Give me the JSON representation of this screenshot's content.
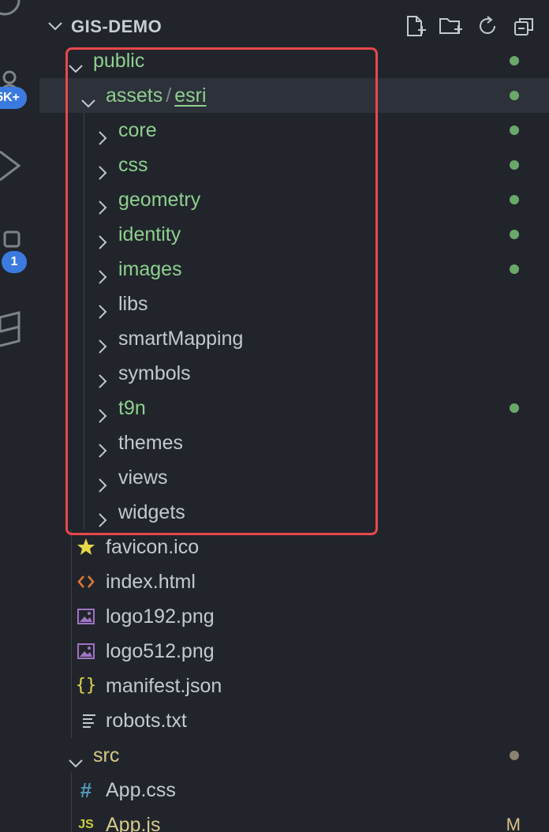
{
  "activity_bar": {
    "badge_top": "5K+",
    "badge_bottom": "1"
  },
  "explorer": {
    "section_title": "GIS-DEMO",
    "actions": [
      "new-file",
      "new-folder",
      "refresh",
      "collapse-all"
    ],
    "rows": [
      {
        "label": "public",
        "type": "folder",
        "expanded": true,
        "depth": 0,
        "color": "green",
        "status": "dot-green"
      },
      {
        "label_a": "assets",
        "label_sep": "/",
        "label_b": "esri",
        "type": "folder",
        "expanded": true,
        "depth": 1,
        "color": "green",
        "status": "dot-green"
      },
      {
        "label": "core",
        "type": "folder",
        "expanded": false,
        "depth": 2,
        "color": "green",
        "status": "dot-green"
      },
      {
        "label": "css",
        "type": "folder",
        "expanded": false,
        "depth": 2,
        "color": "green",
        "status": "dot-green"
      },
      {
        "label": "geometry",
        "type": "folder",
        "expanded": false,
        "depth": 2,
        "color": "green",
        "status": "dot-green"
      },
      {
        "label": "identity",
        "type": "folder",
        "expanded": false,
        "depth": 2,
        "color": "green",
        "status": "dot-green"
      },
      {
        "label": "images",
        "type": "folder",
        "expanded": false,
        "depth": 2,
        "color": "green",
        "status": "dot-green"
      },
      {
        "label": "libs",
        "type": "folder",
        "expanded": false,
        "depth": 2,
        "color": "grey"
      },
      {
        "label": "smartMapping",
        "type": "folder",
        "expanded": false,
        "depth": 2,
        "color": "grey"
      },
      {
        "label": "symbols",
        "type": "folder",
        "expanded": false,
        "depth": 2,
        "color": "grey"
      },
      {
        "label": "t9n",
        "type": "folder",
        "expanded": false,
        "depth": 2,
        "color": "green",
        "status": "dot-green"
      },
      {
        "label": "themes",
        "type": "folder",
        "expanded": false,
        "depth": 2,
        "color": "grey"
      },
      {
        "label": "views",
        "type": "folder",
        "expanded": false,
        "depth": 2,
        "color": "grey"
      },
      {
        "label": "widgets",
        "type": "folder",
        "expanded": false,
        "depth": 2,
        "color": "grey"
      },
      {
        "label": "favicon.ico",
        "type": "file",
        "icon": "star-icon",
        "depth": 1,
        "color": "grey"
      },
      {
        "label": "index.html",
        "type": "file",
        "icon": "html-icon",
        "depth": 1,
        "color": "grey"
      },
      {
        "label": "logo192.png",
        "type": "file",
        "icon": "image-icon",
        "depth": 1,
        "color": "grey"
      },
      {
        "label": "logo512.png",
        "type": "file",
        "icon": "image-icon",
        "depth": 1,
        "color": "grey"
      },
      {
        "label": "manifest.json",
        "type": "file",
        "icon": "json-icon",
        "depth": 1,
        "color": "grey"
      },
      {
        "label": "robots.txt",
        "type": "file",
        "icon": "text-icon",
        "depth": 1,
        "color": "grey"
      },
      {
        "label": "src",
        "type": "folder",
        "expanded": true,
        "depth": 0,
        "color": "yellowish",
        "status": "dot-grey"
      },
      {
        "label": "App.css",
        "type": "file",
        "icon": "css-hash-icon",
        "depth": 1,
        "color": "grey"
      },
      {
        "label": "App.js",
        "type": "file",
        "icon": "js-icon",
        "depth": 1,
        "color": "yellowish",
        "status_letter": "M"
      }
    ]
  },
  "colors": {
    "background": "#21252b",
    "active_row": "#2c313a",
    "folder_green": "#8fcf8f",
    "text_grey": "#c3c8d0",
    "modified": "#d6c98a",
    "highlight_border": "#e8484d",
    "badge": "#3b7be0"
  }
}
